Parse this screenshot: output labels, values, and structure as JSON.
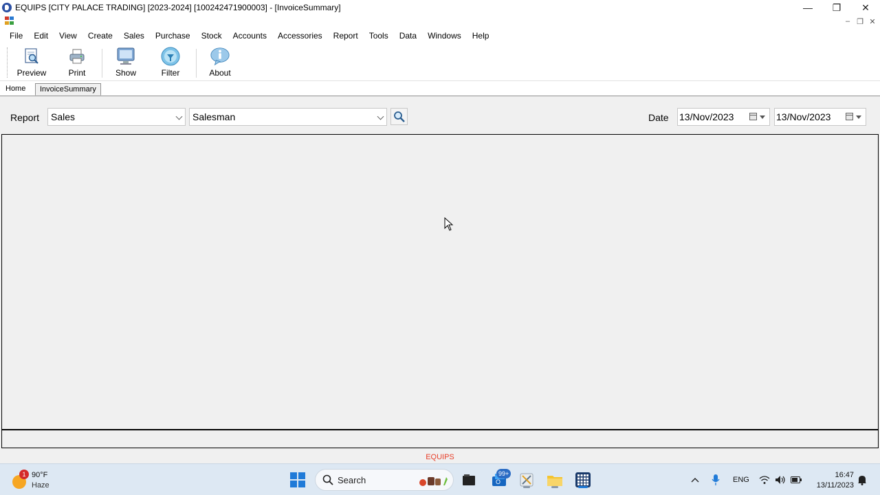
{
  "window": {
    "title": "EQUIPS [CITY PALACE TRADING] [2023-2024] [100242471900003] - [InvoiceSummary]",
    "minimize": "—",
    "restore": "❐",
    "close": "✕"
  },
  "mdi": {
    "minimize": "–",
    "restore": "❐",
    "close": "✕"
  },
  "menu": [
    "File",
    "Edit",
    "View",
    "Create",
    "Sales",
    "Purchase",
    "Stock",
    "Accounts",
    "Accessories",
    "Report",
    "Tools",
    "Data",
    "Windows",
    "Help"
  ],
  "toolbar": {
    "preview": "Preview",
    "print": "Print",
    "show": "Show",
    "filter": "Filter",
    "about": "About"
  },
  "tabs": {
    "home": "Home",
    "active": "InvoiceSummary"
  },
  "filters": {
    "report_label": "Report",
    "report_value": "Sales",
    "group_value": "Salesman",
    "date_label": "Date",
    "date_from": "13/Nov/2023",
    "date_to": "13/Nov/2023"
  },
  "status": {
    "app_name": "EQUIPS"
  },
  "taskbar": {
    "weather_badge": "1",
    "temperature": "90°F",
    "condition": "Haze",
    "search_label": "Search",
    "mail_badge": "99+",
    "language": "ENG",
    "time": "16:47",
    "date": "13/11/2023"
  },
  "colors": {
    "accent": "#1f7ad8",
    "status_text": "#e8402a",
    "panel_bg": "#f0f0f0"
  }
}
